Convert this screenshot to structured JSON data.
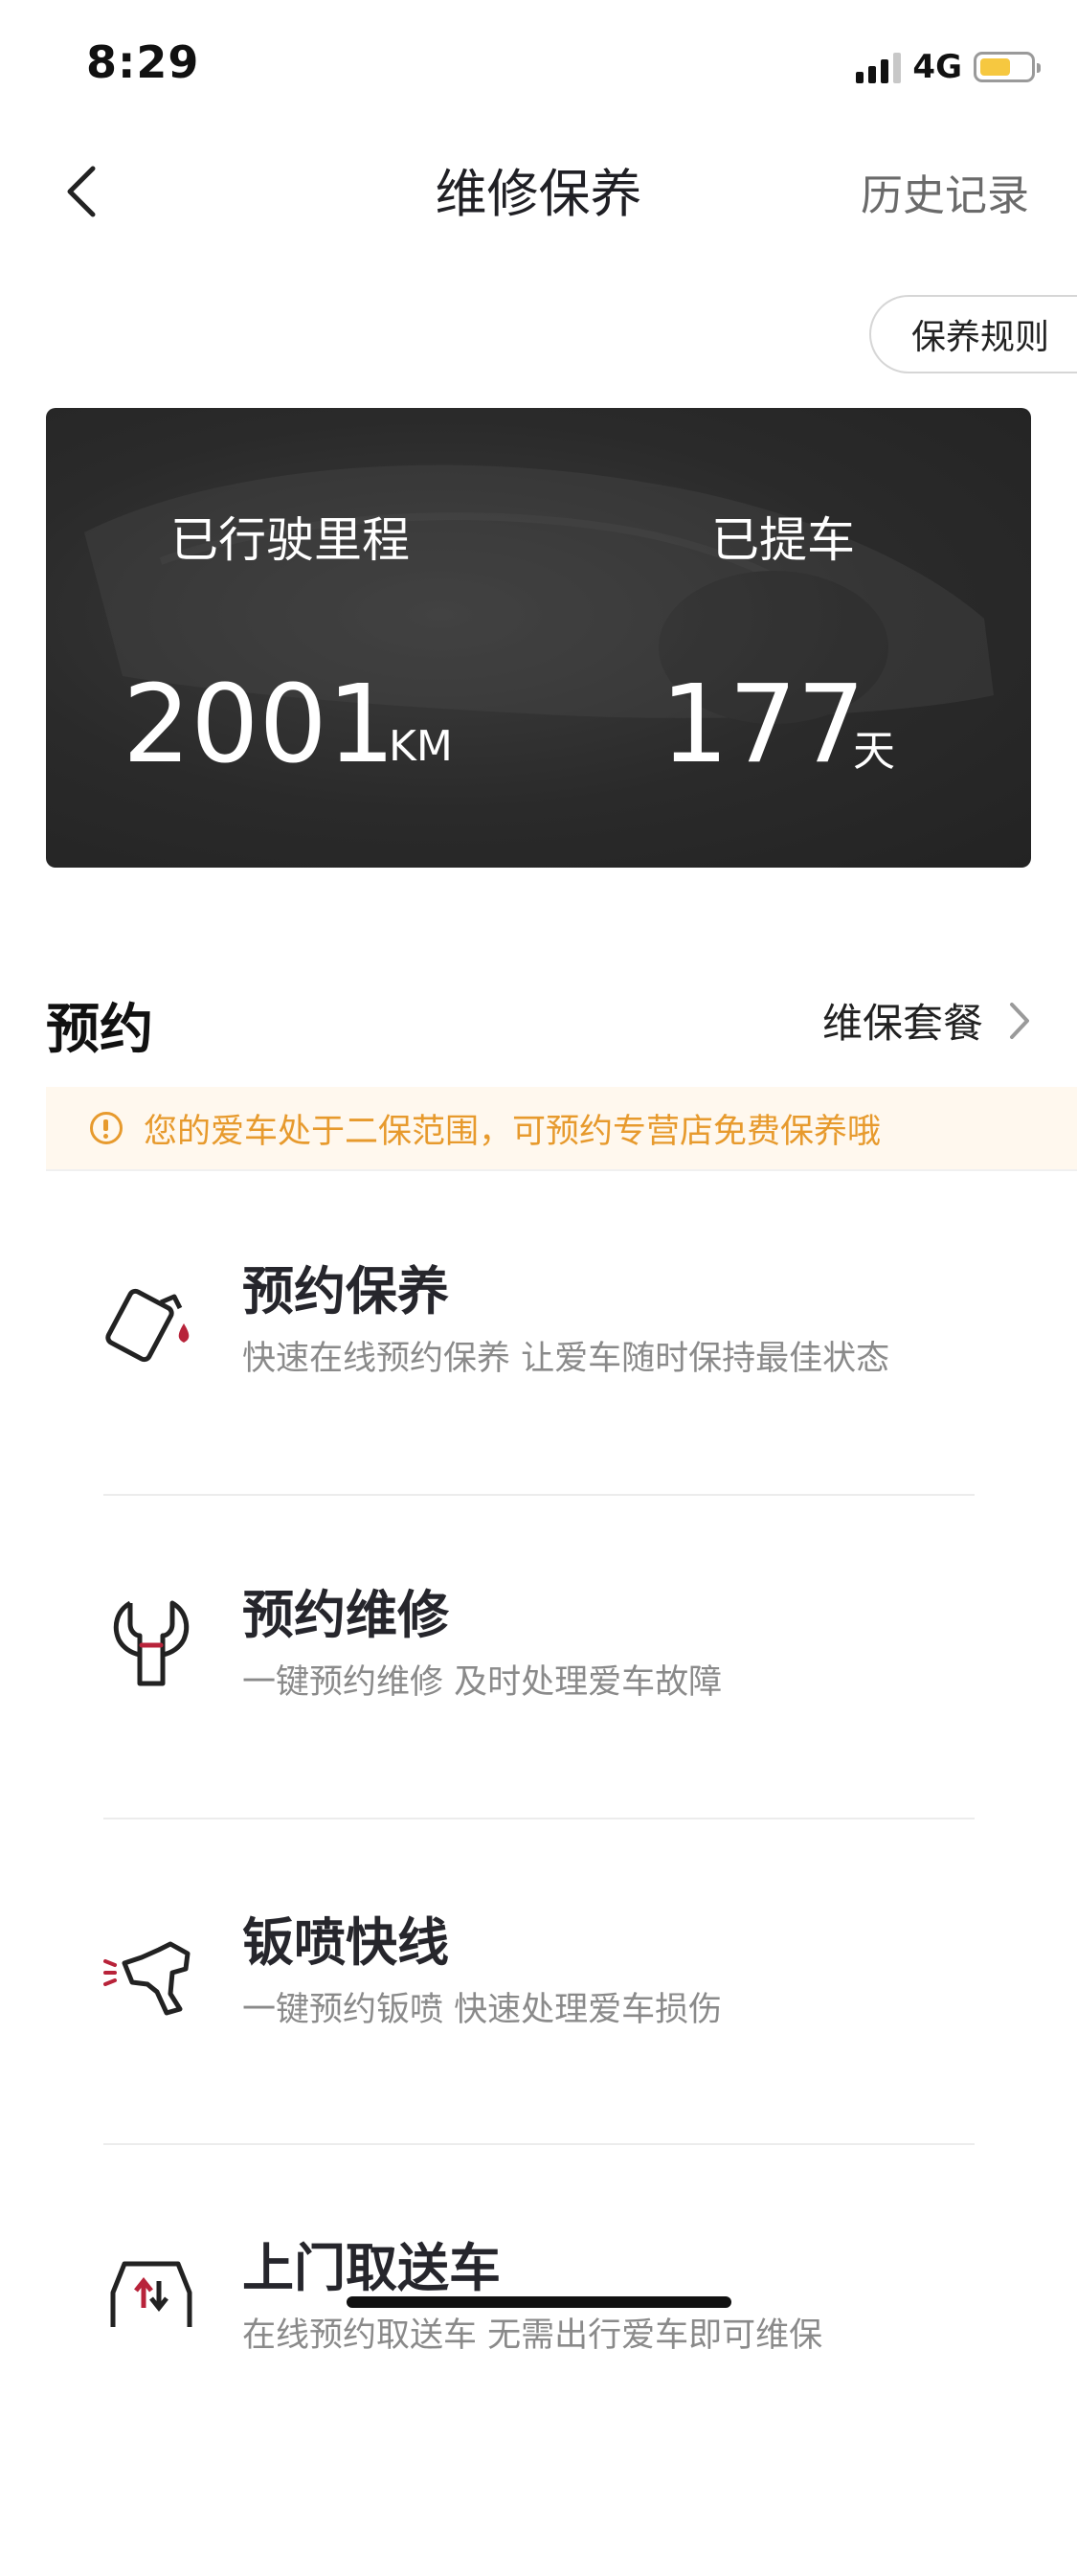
{
  "status_bar": {
    "time": "8:29",
    "network": "4G",
    "battery_level": 0.62,
    "signal_bars_active": 3,
    "battery_color": "#f6c840"
  },
  "nav": {
    "back_icon": "chevron-left-icon",
    "title": "维修保养",
    "history_label": "历史记录"
  },
  "rules_button_label": "保养规则",
  "stats": {
    "mileage_label": "已行驶里程",
    "mileage_value": "2001",
    "mileage_unit": "KM",
    "pickup_label": "已提车",
    "pickup_value": "177",
    "pickup_unit": "天"
  },
  "appointment": {
    "title": "预约",
    "packages_link": "维保套餐",
    "packages_icon": "chevron-right-icon"
  },
  "notice": {
    "icon": "alert-circle-icon",
    "text": "您的爱车处于二保范围，可预约专营店免费保养哦",
    "color": "#e79a2d"
  },
  "services": [
    {
      "icon": "oil-can-icon",
      "title": "预约保养",
      "desc": "快速在线预约保养 让爱车随时保持最佳状态"
    },
    {
      "icon": "wrench-icon",
      "title": "预约维修",
      "desc": "一键预约维修 及时处理爱车故障"
    },
    {
      "icon": "spray-gun-icon",
      "title": "钣喷快线",
      "desc": "一键预约钣喷 快速处理爱车损伤"
    },
    {
      "icon": "car-pickup-icon",
      "title": "上门取送车",
      "desc": "在线预约取送车 无需出行爱车即可维保"
    }
  ],
  "accent_red": "#b8233a"
}
